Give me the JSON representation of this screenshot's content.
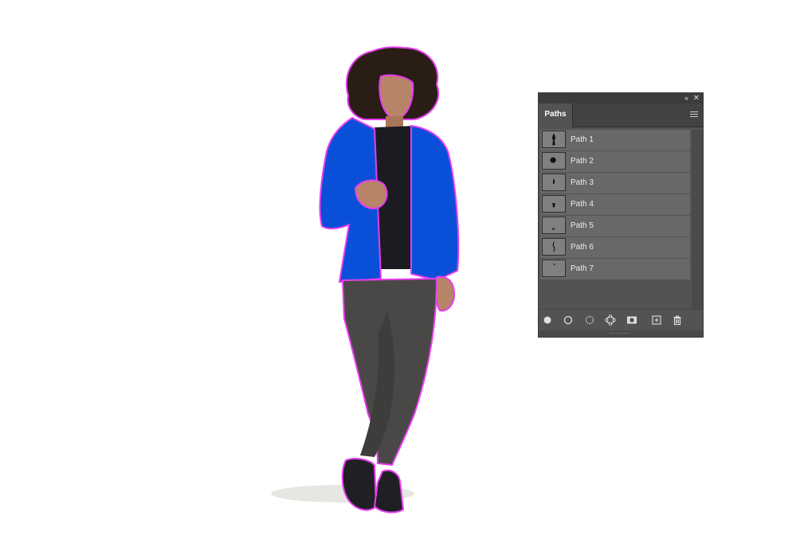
{
  "panel": {
    "title": "Paths",
    "collapse_glyph": "‹‹",
    "close_glyph": "✕",
    "paths": [
      {
        "label": "Path 1"
      },
      {
        "label": "Path 2"
      },
      {
        "label": "Path 3"
      },
      {
        "label": "Path 4"
      },
      {
        "label": "Path 5"
      },
      {
        "label": "Path 6"
      },
      {
        "label": "Path 7"
      }
    ],
    "tools": [
      "fill-path-icon",
      "stroke-path-icon",
      "load-selection-icon",
      "make-work-path-icon",
      "add-mask-icon",
      "new-path-icon",
      "delete-path-icon"
    ]
  },
  "colors": {
    "path_outline": "#e83cf0",
    "jacket": "#0a4fd8",
    "leggings": "#4a4846",
    "shirt": "#1c1b22",
    "hair": "#2a1d16",
    "skin": "#b88468"
  }
}
